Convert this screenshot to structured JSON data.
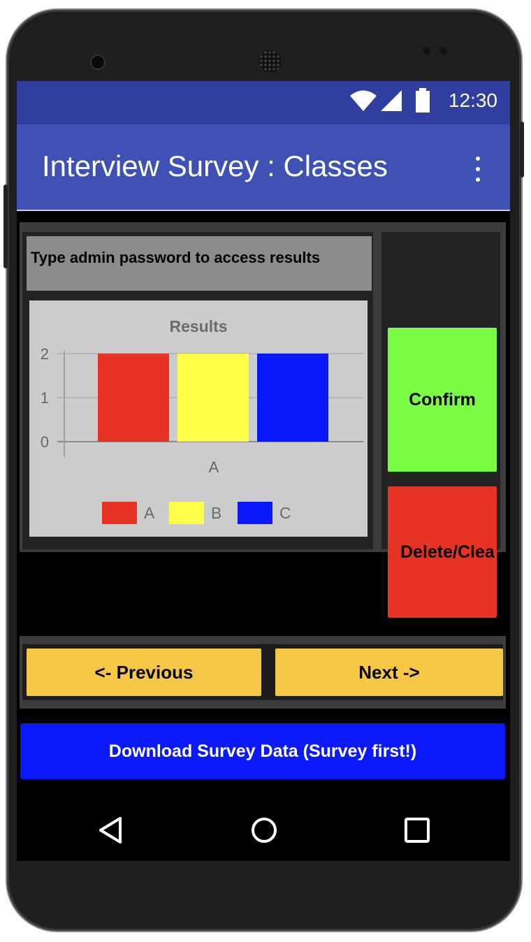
{
  "status_bar": {
    "time": "12:30",
    "icons": [
      "wifi-icon",
      "signal-icon",
      "battery-icon"
    ]
  },
  "app_bar": {
    "title": "Interview Survey : Classes",
    "menu_icon": "more-vert-icon"
  },
  "admin_prompt": "Type admin password to access results",
  "buttons": {
    "confirm": "Confirm",
    "delete": "Delete/Clea",
    "previous": "<- Previous",
    "next": "Next ->",
    "download": "Download Survey Data (Survey first!)"
  },
  "colors": {
    "status_bar": "#303f9f",
    "app_bar": "#3f51b5",
    "confirm": "#7dfc45",
    "delete": "#e63323",
    "nav_buttons": "#f6c745",
    "download": "#0b19fb"
  },
  "navigation": {
    "icons": [
      "back-icon",
      "home-icon",
      "recents-icon"
    ]
  },
  "chart_data": {
    "type": "bar",
    "title": "Results",
    "categories": [
      "A"
    ],
    "series": [
      {
        "name": "A",
        "values": [
          2
        ],
        "color": "#e63323"
      },
      {
        "name": "B",
        "values": [
          2
        ],
        "color": "#ffff4a"
      },
      {
        "name": "C",
        "values": [
          2
        ],
        "color": "#0a19fb"
      }
    ],
    "ylim": [
      0,
      2
    ],
    "yticks": [
      "0",
      "1",
      "2"
    ],
    "grid": true,
    "legend": "bottom"
  }
}
